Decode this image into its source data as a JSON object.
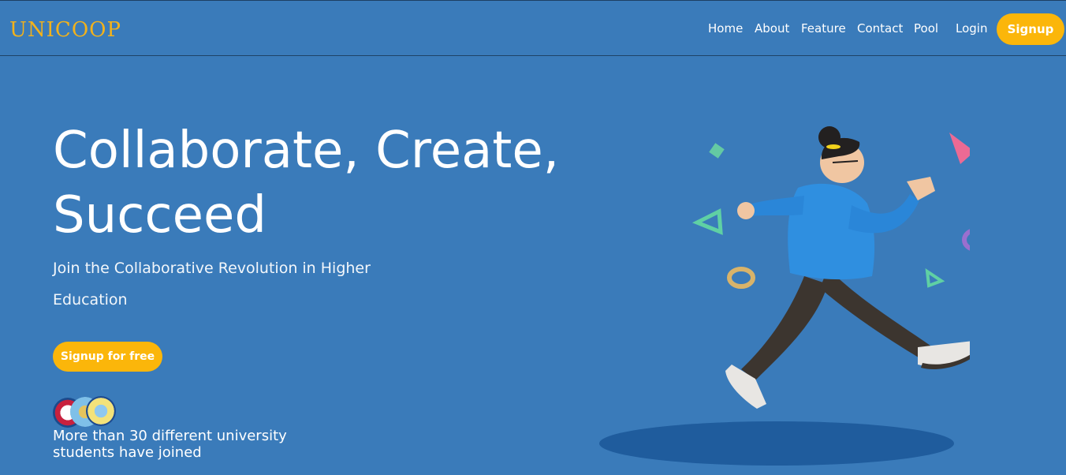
{
  "header": {
    "logo": "UNICOOP",
    "nav": [
      "Home",
      "About",
      "Feature",
      "Contact",
      "Pool",
      "Login"
    ],
    "signup_label": "Signup"
  },
  "hero": {
    "title": "Collaborate, Create, Succeed",
    "subtitle": "Join the Collaborative Revolution in Higher Education",
    "cta_label": "Signup for free",
    "social_proof": "More than 30 different university students have joined"
  },
  "colors": {
    "background": "#3a7bba",
    "accent": "#fbb60a",
    "logo": "#f2b21b"
  },
  "icons": [
    "university-badge-icon",
    "university-badge-icon",
    "university-badge-icon"
  ]
}
